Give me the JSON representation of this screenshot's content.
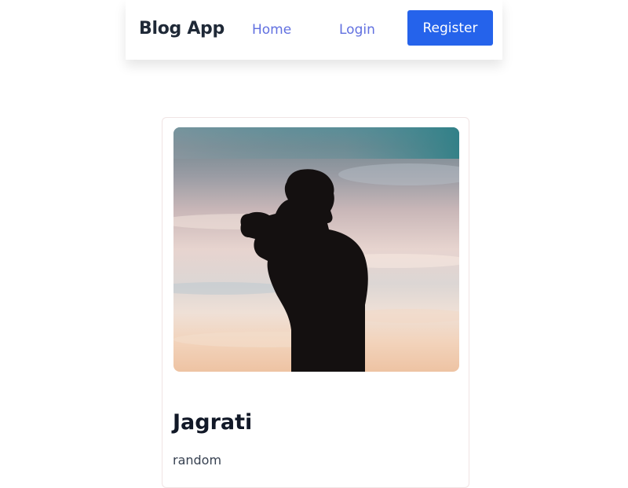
{
  "navbar": {
    "brand": "Blog App",
    "links": {
      "home": "Home",
      "login": "Login"
    },
    "register_label": "Register"
  },
  "post": {
    "title": "Jagrati",
    "body": "random",
    "image_icon": "photographer-silhouette-image"
  },
  "colors": {
    "accent": "#2563eb",
    "link": "#6170e0",
    "heading": "#111827"
  }
}
